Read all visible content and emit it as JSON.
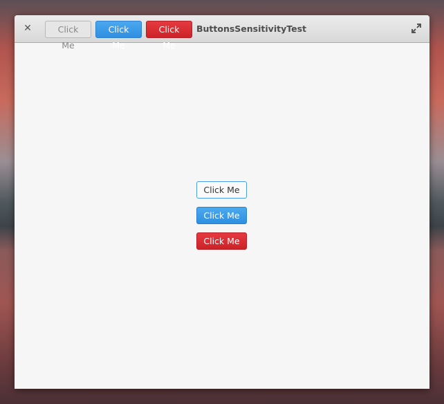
{
  "window": {
    "title": "ButtonsSensitivityTest"
  },
  "header": {
    "buttons": [
      {
        "label": "Click Me",
        "state": "insensitive"
      },
      {
        "label": "Click Me",
        "style": "suggested"
      },
      {
        "label": "Click Me",
        "style": "destructive"
      }
    ]
  },
  "content": {
    "buttons": [
      {
        "label": "Click Me",
        "style": "default"
      },
      {
        "label": "Click Me",
        "style": "suggested"
      },
      {
        "label": "Click Me",
        "style": "destructive"
      }
    ]
  }
}
